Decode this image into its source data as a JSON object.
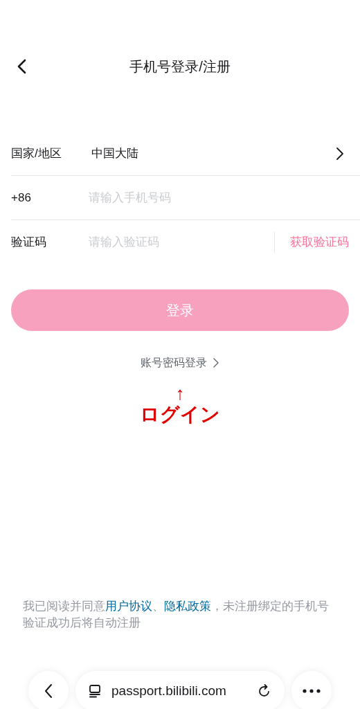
{
  "header": {
    "title": "手机号登录/注册"
  },
  "form": {
    "rows": [
      {
        "kind": "select",
        "label": "国家/地区",
        "value": "中国大陆"
      },
      {
        "kind": "input",
        "label": "+86",
        "placeholder": "请输入手机号码"
      },
      {
        "kind": "code",
        "label": "验证码",
        "placeholder": "请输入验证码",
        "action": "获取验证码"
      }
    ]
  },
  "login_button": {
    "label": "登录",
    "disabled": true
  },
  "password_login_link": "账号密码登录",
  "annotation": {
    "arrow": "↑",
    "text": "ログイン"
  },
  "agreement": [
    {
      "kind": "text",
      "text": "我已阅读并同意"
    },
    {
      "kind": "link",
      "text": "用户协议"
    },
    {
      "kind": "text",
      "text": "、"
    },
    {
      "kind": "link",
      "text": "隐私政策"
    },
    {
      "kind": "text",
      "text": "，未注册绑定的手机号验证成功后将自动注册"
    }
  ],
  "browser_bar": {
    "url": "passport.bilibili.com"
  }
}
